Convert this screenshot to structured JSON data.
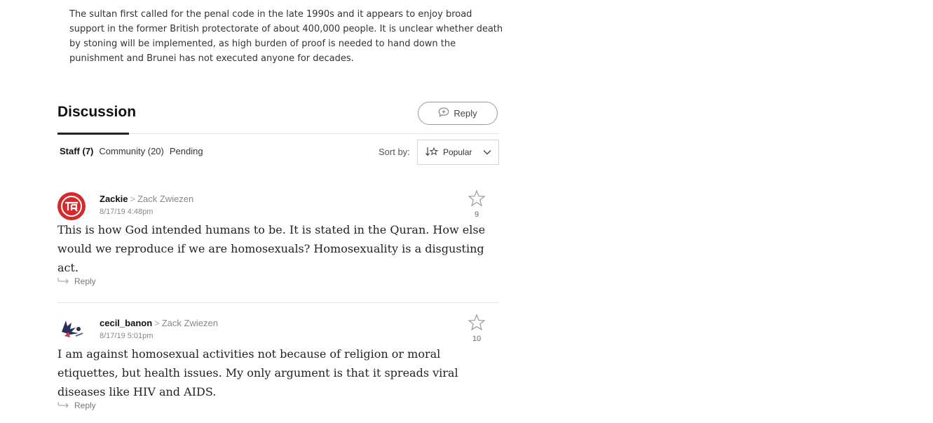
{
  "article": {
    "paragraph": "The sultan first called for the penal code in the late 1990s and it appears to enjoy broad support in the former British protectorate of about 400,000 people. It is unclear whether death by stoning will be implemented, as high burden of proof is needed to hand down the punishment and Brunei has not executed anyone for decades."
  },
  "discussion": {
    "title": "Discussion",
    "reply_label": "Reply",
    "tabs": [
      {
        "label": "Staff (7)"
      },
      {
        "label": "Community (20)"
      },
      {
        "label": "Pending"
      }
    ],
    "sort_label": "Sort by:",
    "sort_value": "Popular"
  },
  "comments": [
    {
      "author": "Zackie",
      "reply_to": "Zack Zwiezen",
      "timestamp": "8/17/19 4:48pm",
      "stars": "9",
      "body": "This is how God intended humans to be. It is stated in the Quran. How else would we reproduce if we are homosexuals? Homosexuality is a disgusting act.",
      "reply_label": "Reply"
    },
    {
      "author": "cecil_banon",
      "reply_to": "Zack Zwiezen",
      "timestamp": "8/17/19 5:01pm",
      "stars": "10",
      "body": "I am against homosexual activities not because of religion or moral etiquettes, but health issues. My only argument is that it spreads viral diseases like HIV and AIDS.",
      "reply_label": "Reply"
    }
  ],
  "colors": {
    "avatar_red": "#d42a2a",
    "text_dark": "#222222",
    "text_muted": "#888888",
    "rule": "#e4e4e4"
  },
  "icons": {
    "reply_pill": "speech-bubble-plus-icon",
    "sort": "sort-star-icon",
    "chevron": "chevron-down-icon",
    "star": "star-outline-icon",
    "reply_arrow": "reply-arrow-icon"
  }
}
